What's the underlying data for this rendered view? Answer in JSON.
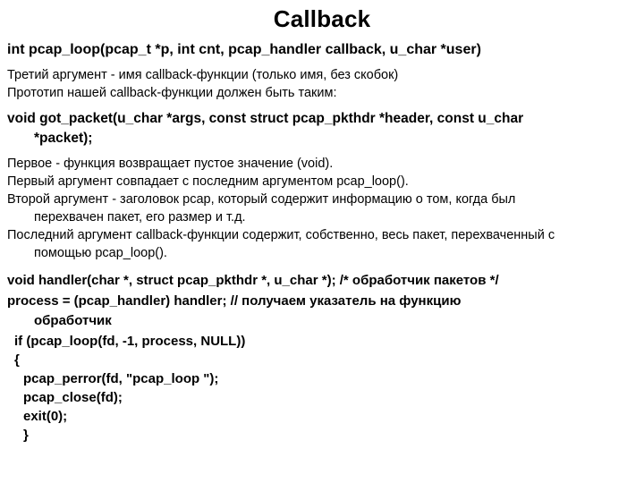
{
  "title": "Callback",
  "sig_loop": "int pcap_loop(pcap_t *p, int cnt, pcap_handler callback, u_char *user)",
  "para1": "Третий аргумент - имя callback-функции (только имя, без скобок)",
  "para2": "Прототип нашей callback-функции должен быть таким:",
  "sig_got": "void got_packet(u_char *args, const struct pcap_pkthdr *header, const u_char",
  "sig_got_cont": "*packet);",
  "p_first": "Первое - функция возвращает пустое значение (void).",
  "p_arg1": "Первый аргумент совпадает с последним аргументом pcap_loop().",
  "p_arg2a": "Второй аргумент - заголовок pcap, который содержит информацию о том, когда был",
  "p_arg2b": "перехвачен пакет, его размер и т.д.",
  "p_lasta": "Последний аргумент callback-функции содержит, собственно, весь пакет, перехваченный с",
  "p_lastb": "помощью pcap_loop().",
  "c_handler": "void handler(char *, struct pcap_pkthdr *, u_char *); /* обработчик пакетов */",
  "c_process1": "  process = (pcap_handler) handler; // получаем указатель на функцию",
  "c_process2": "обработчик",
  "c_if": "if (pcap_loop(fd, -1, process, NULL))",
  "c_ob": "{",
  "c_perr": "pcap_perror(fd, \"pcap_loop \");",
  "c_close": "pcap_close(fd);",
  "c_exit": "exit(0);",
  "c_cb": "}"
}
